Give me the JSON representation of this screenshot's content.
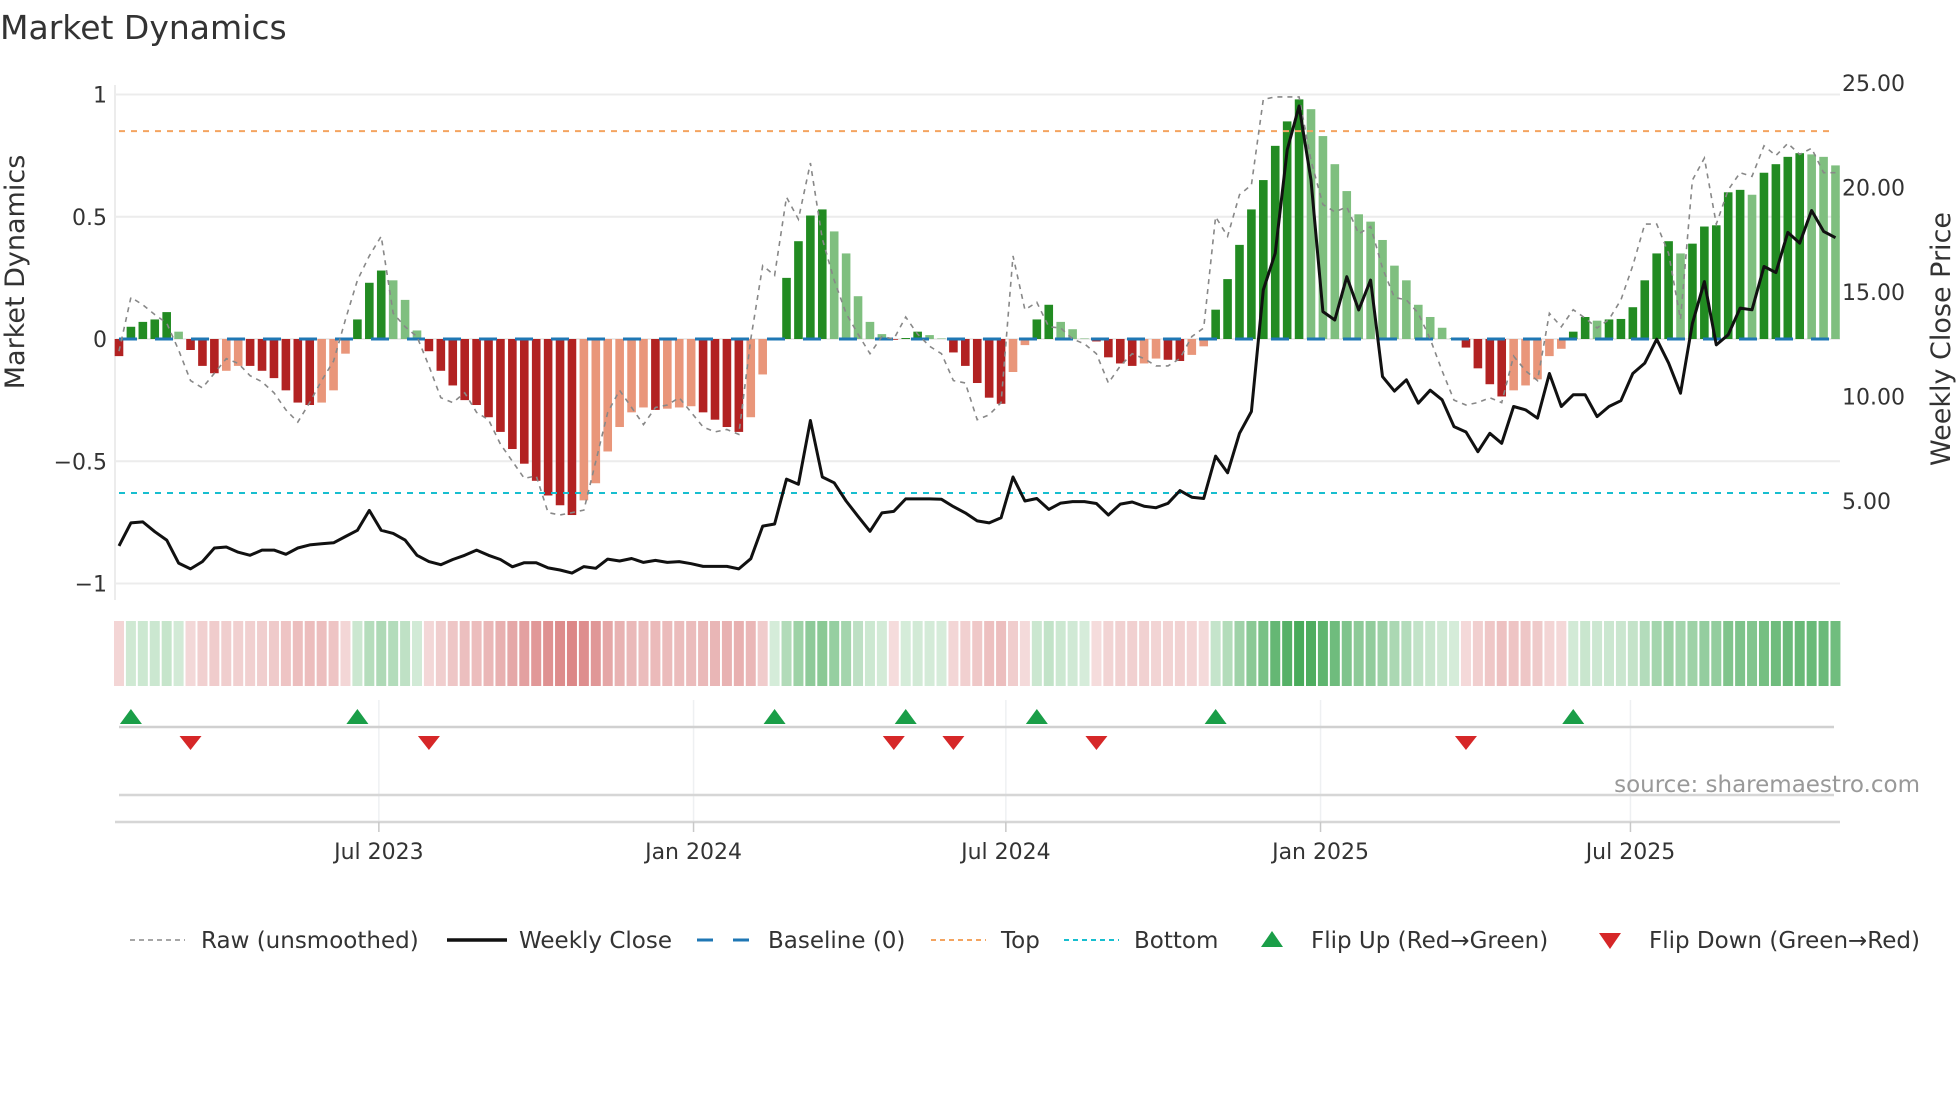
{
  "title": "Market Dynamics",
  "source": "source: sharemaestro.com",
  "chart_data": {
    "type": "bar",
    "title": "Market Dynamics",
    "ylabel": "Market Dynamics",
    "y2label": "Weekly Close Price",
    "ylim": [
      -1.05,
      1.05
    ],
    "y2lim": [
      0,
      25
    ],
    "grid": true,
    "legend_placement": "bottom",
    "yticks": [
      {
        "value": 1,
        "label": "1"
      },
      {
        "value": 0.5,
        "label": "0.5"
      },
      {
        "value": 0,
        "label": "0"
      },
      {
        "value": -0.5,
        "label": "−0.5"
      },
      {
        "value": -1,
        "label": "−1"
      }
    ],
    "y2ticks": [
      {
        "value": 25,
        "label": "25.00"
      },
      {
        "value": 20,
        "label": "20.00"
      },
      {
        "value": 15,
        "label": "15.00"
      },
      {
        "value": 10,
        "label": "10.00"
      },
      {
        "value": 5,
        "label": "5.00"
      }
    ],
    "xticks": [
      {
        "week": 21.8,
        "label": "Jul 2023"
      },
      {
        "week": 48.2,
        "label": "Jan 2024"
      },
      {
        "week": 74.4,
        "label": "Jul 2024"
      },
      {
        "week": 100.8,
        "label": "Jan 2025"
      },
      {
        "week": 126.8,
        "label": "Jul 2025"
      }
    ],
    "thresholds": {
      "baseline": 0,
      "top": 0.85,
      "bottom": -0.63
    },
    "colors": {
      "pos_rising": "#228b22",
      "pos_falling": "#7fbf7f",
      "neg_rising": "#b22222",
      "neg_falling": "#e9967a",
      "raw": "#888888",
      "close": "#111111",
      "baseline": "#1f77b4",
      "top": "#f4a460",
      "bottom": "#17becf",
      "flip_up": "#1a9e48",
      "flip_down": "#d62728"
    },
    "series": [
      {
        "name": "Market Dynamics (smoothed)",
        "type": "bar",
        "values": [
          -0.07,
          0.05,
          0.07,
          0.08,
          0.11,
          0.03,
          -0.045,
          -0.11,
          -0.14,
          -0.13,
          -0.11,
          -0.11,
          -0.13,
          -0.16,
          -0.21,
          -0.26,
          -0.27,
          -0.26,
          -0.21,
          -0.06,
          0.08,
          0.23,
          0.28,
          0.24,
          0.16,
          0.035,
          -0.05,
          -0.13,
          -0.19,
          -0.25,
          -0.27,
          -0.32,
          -0.38,
          -0.45,
          -0.51,
          -0.58,
          -0.64,
          -0.68,
          -0.72,
          -0.66,
          -0.59,
          -0.46,
          -0.36,
          -0.3,
          -0.28,
          -0.29,
          -0.285,
          -0.28,
          -0.275,
          -0.3,
          -0.33,
          -0.36,
          -0.38,
          -0.32,
          -0.145,
          0.005,
          0.25,
          0.4,
          0.505,
          0.53,
          0.44,
          0.35,
          0.175,
          0.07,
          0.02,
          -0.003,
          0.004,
          0.03,
          0.016,
          0.002,
          -0.055,
          -0.11,
          -0.18,
          -0.24,
          -0.265,
          -0.135,
          -0.025,
          0.08,
          0.14,
          0.07,
          0.04,
          0.002,
          -0.01,
          -0.075,
          -0.1,
          -0.11,
          -0.1,
          -0.08,
          -0.085,
          -0.09,
          -0.065,
          -0.03,
          0.12,
          0.245,
          0.385,
          0.53,
          0.65,
          0.79,
          0.89,
          0.98,
          0.94,
          0.83,
          0.715,
          0.605,
          0.51,
          0.48,
          0.405,
          0.3,
          0.24,
          0.14,
          0.09,
          0.046,
          0.004,
          -0.035,
          -0.12,
          -0.185,
          -0.235,
          -0.21,
          -0.19,
          -0.165,
          -0.07,
          -0.04,
          0.03,
          0.09,
          0.075,
          0.08,
          0.082,
          0.13,
          0.24,
          0.35,
          0.4,
          0.35,
          0.39,
          0.46,
          0.465,
          0.6,
          0.61,
          0.59,
          0.68,
          0.715,
          0.745,
          0.76,
          0.755,
          0.745,
          0.71
        ]
      },
      {
        "name": "Raw (unsmoothed)",
        "type": "line",
        "values": [
          -0.05,
          0.17,
          0.14,
          0.1,
          0.065,
          -0.045,
          -0.17,
          -0.2,
          -0.14,
          -0.08,
          -0.1,
          -0.15,
          -0.175,
          -0.22,
          -0.29,
          -0.34,
          -0.26,
          -0.17,
          -0.09,
          0.08,
          0.24,
          0.34,
          0.42,
          0.105,
          0.05,
          0.01,
          -0.11,
          -0.24,
          -0.26,
          -0.22,
          -0.3,
          -0.33,
          -0.43,
          -0.5,
          -0.57,
          -0.56,
          -0.71,
          -0.72,
          -0.71,
          -0.7,
          -0.5,
          -0.3,
          -0.21,
          -0.28,
          -0.35,
          -0.28,
          -0.27,
          -0.24,
          -0.3,
          -0.36,
          -0.38,
          -0.37,
          -0.39,
          0.0,
          0.3,
          0.26,
          0.58,
          0.49,
          0.72,
          0.41,
          0.24,
          0.105,
          0.02,
          -0.06,
          0.01,
          0.0,
          0.09,
          0.02,
          -0.03,
          -0.06,
          -0.17,
          -0.18,
          -0.33,
          -0.31,
          -0.26,
          0.34,
          0.12,
          0.15,
          0.05,
          0.045,
          0.0,
          -0.02,
          -0.06,
          -0.18,
          -0.11,
          -0.06,
          -0.08,
          -0.11,
          -0.11,
          -0.08,
          0.01,
          0.045,
          0.5,
          0.42,
          0.59,
          0.63,
          0.98,
          0.99,
          0.99,
          0.99,
          0.73,
          0.55,
          0.52,
          0.54,
          0.43,
          0.46,
          0.29,
          0.17,
          0.16,
          0.105,
          0.0,
          -0.13,
          -0.25,
          -0.27,
          -0.26,
          -0.24,
          -0.26,
          -0.07,
          -0.13,
          -0.17,
          0.105,
          0.05,
          0.12,
          0.085,
          0.045,
          0.08,
          0.16,
          0.3,
          0.47,
          0.47,
          0.35,
          0.08,
          0.65,
          0.74,
          0.47,
          0.61,
          0.68,
          0.665,
          0.79,
          0.75,
          0.8,
          0.755,
          0.78,
          0.68,
          0.68
        ]
      },
      {
        "name": "Weekly Close",
        "type": "line",
        "axis": "right",
        "values": [
          2.85,
          3.95,
          4.0,
          3.53,
          3.13,
          2.03,
          1.75,
          2.1,
          2.75,
          2.8,
          2.55,
          2.4,
          2.65,
          2.65,
          2.45,
          2.75,
          2.9,
          2.95,
          3.0,
          3.3,
          3.6,
          4.55,
          3.6,
          3.45,
          3.13,
          2.4,
          2.1,
          1.95,
          2.2,
          2.4,
          2.65,
          2.4,
          2.2,
          1.85,
          2.05,
          2.05,
          1.8,
          1.7,
          1.55,
          1.86,
          1.78,
          2.22,
          2.13,
          2.25,
          2.06,
          2.16,
          2.06,
          2.1,
          2.0,
          1.87,
          1.87,
          1.87,
          1.75,
          2.24,
          3.8,
          3.9,
          6.05,
          5.8,
          8.85,
          6.15,
          5.87,
          5.0,
          4.27,
          3.55,
          4.43,
          4.5,
          5.1,
          5.1,
          5.1,
          5.08,
          4.73,
          4.43,
          4.05,
          3.95,
          4.2,
          6.15,
          5.0,
          5.12,
          4.6,
          4.9,
          4.97,
          4.97,
          4.88,
          4.33,
          4.85,
          4.95,
          4.75,
          4.68,
          4.89,
          5.5,
          5.18,
          5.12,
          7.15,
          6.35,
          8.24,
          9.28,
          15.1,
          16.85,
          21.8,
          23.9,
          20.36,
          14.06,
          13.66,
          15.73,
          14.14,
          15.57,
          10.95,
          10.26,
          10.8,
          9.68,
          10.3,
          9.84,
          8.56,
          8.3,
          7.36,
          8.24,
          7.76,
          9.52,
          9.36,
          8.96,
          11.1,
          9.52,
          10.08,
          10.08,
          9.04,
          9.52,
          9.8,
          11.1,
          11.6,
          12.74,
          11.6,
          10.16,
          13.5,
          15.5,
          12.47,
          12.95,
          14.23,
          14.15,
          16.22,
          15.93,
          17.85,
          17.34,
          18.9,
          17.9,
          17.6
        ]
      }
    ],
    "flip_up_weeks": [
      1,
      20,
      55,
      66,
      77,
      92,
      122
    ],
    "flip_down_weeks": [
      6,
      26,
      65,
      70,
      82,
      113
    ],
    "legend": [
      {
        "key": "raw",
        "label": "Raw (unsmoothed)"
      },
      {
        "key": "close",
        "label": "Weekly Close"
      },
      {
        "key": "baseline",
        "label": "Baseline (0)"
      },
      {
        "key": "top",
        "label": "Top"
      },
      {
        "key": "bottom",
        "label": "Bottom"
      },
      {
        "key": "flip_up",
        "label": "Flip Up (Red→Green)"
      },
      {
        "key": "flip_down",
        "label": "Flip Down (Green→Red)"
      }
    ]
  }
}
